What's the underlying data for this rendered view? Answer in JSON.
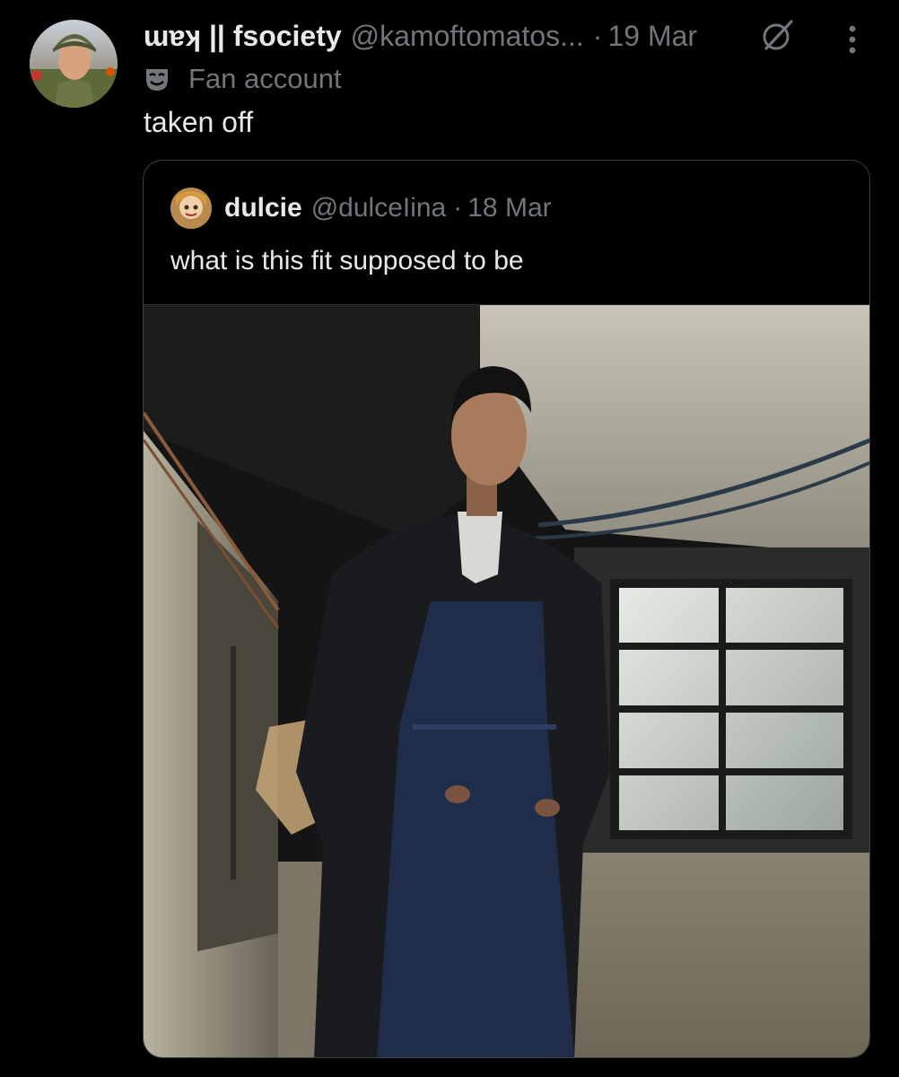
{
  "tweet": {
    "display_name": "ɯɐʞ || fsociety",
    "handle": "@kamoftomatos...",
    "separator": "·",
    "date": "19 Mar",
    "label": "Fan account",
    "text": "taken off",
    "avatar_icon": "avatar-photo",
    "badge_icon": "theater-mask-icon",
    "actions_icon": "more-vertical-icon",
    "grok_icon": "grok-icon"
  },
  "quoted_tweet": {
    "display_name": "dulcie",
    "handle": "@dulceIina",
    "separator": "·",
    "date": "18 Mar",
    "text": "what is this fit supposed to be",
    "media": "photo"
  },
  "colors": {
    "background": "#000000",
    "primary_text": "#e7e9ea",
    "secondary_text": "#71767b",
    "border": "#3b3f43"
  }
}
